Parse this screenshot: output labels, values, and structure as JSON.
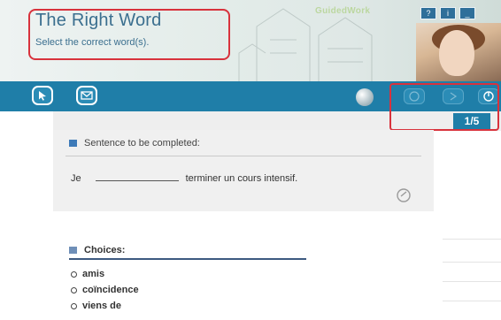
{
  "header": {
    "title": "The Right Word",
    "subtitle": "Select the correct word(s).",
    "brand": "GuidedWork",
    "window_controls": [
      "?",
      "i",
      "_"
    ]
  },
  "toolbar": {
    "left_icons": [
      "cursor-icon",
      "mail-icon"
    ],
    "right_icons": [
      "sphere-icon",
      "prev-icon",
      "next-icon",
      "exit-icon"
    ]
  },
  "progress": {
    "counter": "1/5",
    "current": 1,
    "total": 5
  },
  "question": {
    "heading": "Sentence to be completed:",
    "prefix": "Je",
    "suffix": "terminer un cours intensif."
  },
  "choices": {
    "heading": "Choices:",
    "items": [
      "amis",
      "coïncidence",
      "viens de"
    ]
  },
  "colors": {
    "accent": "#1f7ea8",
    "highlight": "#d8323c",
    "title": "#3b6f8f"
  }
}
